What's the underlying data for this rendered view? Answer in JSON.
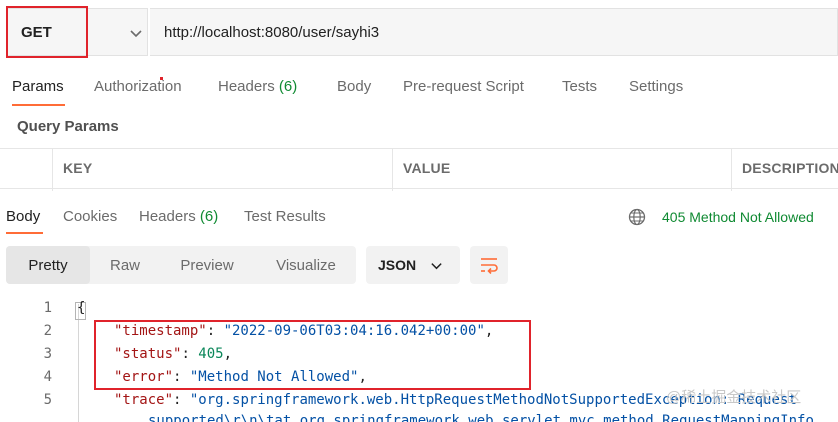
{
  "request": {
    "method": "GET",
    "url": "http://localhost:8080/user/sayhi3"
  },
  "request_tabs": {
    "params": "Params",
    "authorization": "Authorization",
    "headers": "Headers",
    "headers_count": "(6)",
    "body": "Body",
    "prerequest": "Pre-request Script",
    "tests": "Tests",
    "settings": "Settings"
  },
  "query_params": {
    "title": "Query Params",
    "columns": [
      "KEY",
      "VALUE",
      "DESCRIPTION"
    ]
  },
  "response_tabs": {
    "body": "Body",
    "cookies": "Cookies",
    "headers": "Headers",
    "headers_count": "(6)",
    "test_results": "Test Results"
  },
  "status": {
    "text": "405 Method Not Allowed",
    "color": "#0f8a32"
  },
  "view_modes": [
    "Pretty",
    "Raw",
    "Preview",
    "Visualize"
  ],
  "format": "JSON",
  "code": {
    "line_numbers": [
      "1",
      "2",
      "3",
      "4",
      "5"
    ],
    "line1": "{",
    "line2_key": "\"timestamp\"",
    "line2_value": "\"2022-09-06T03:04:16.042+00:00\"",
    "line3_key": "\"status\"",
    "line3_value": "405",
    "line4_key": "\"error\"",
    "line4_value": "\"Method Not Allowed\"",
    "line5_key": "\"trace\"",
    "line5_value": "\"org.springframework.web.HttpRequestMethodNotSupportedException: Request",
    "line6_value": "supported\\r\\n\\tat org.springframework.web.servlet.mvc.method.RequestMappingInfo"
  },
  "watermark": "@稀土掘金技术社区",
  "colors": {
    "accent": "#ff6c37",
    "highlight_border": "#e0232b",
    "success": "#0f8a32"
  }
}
